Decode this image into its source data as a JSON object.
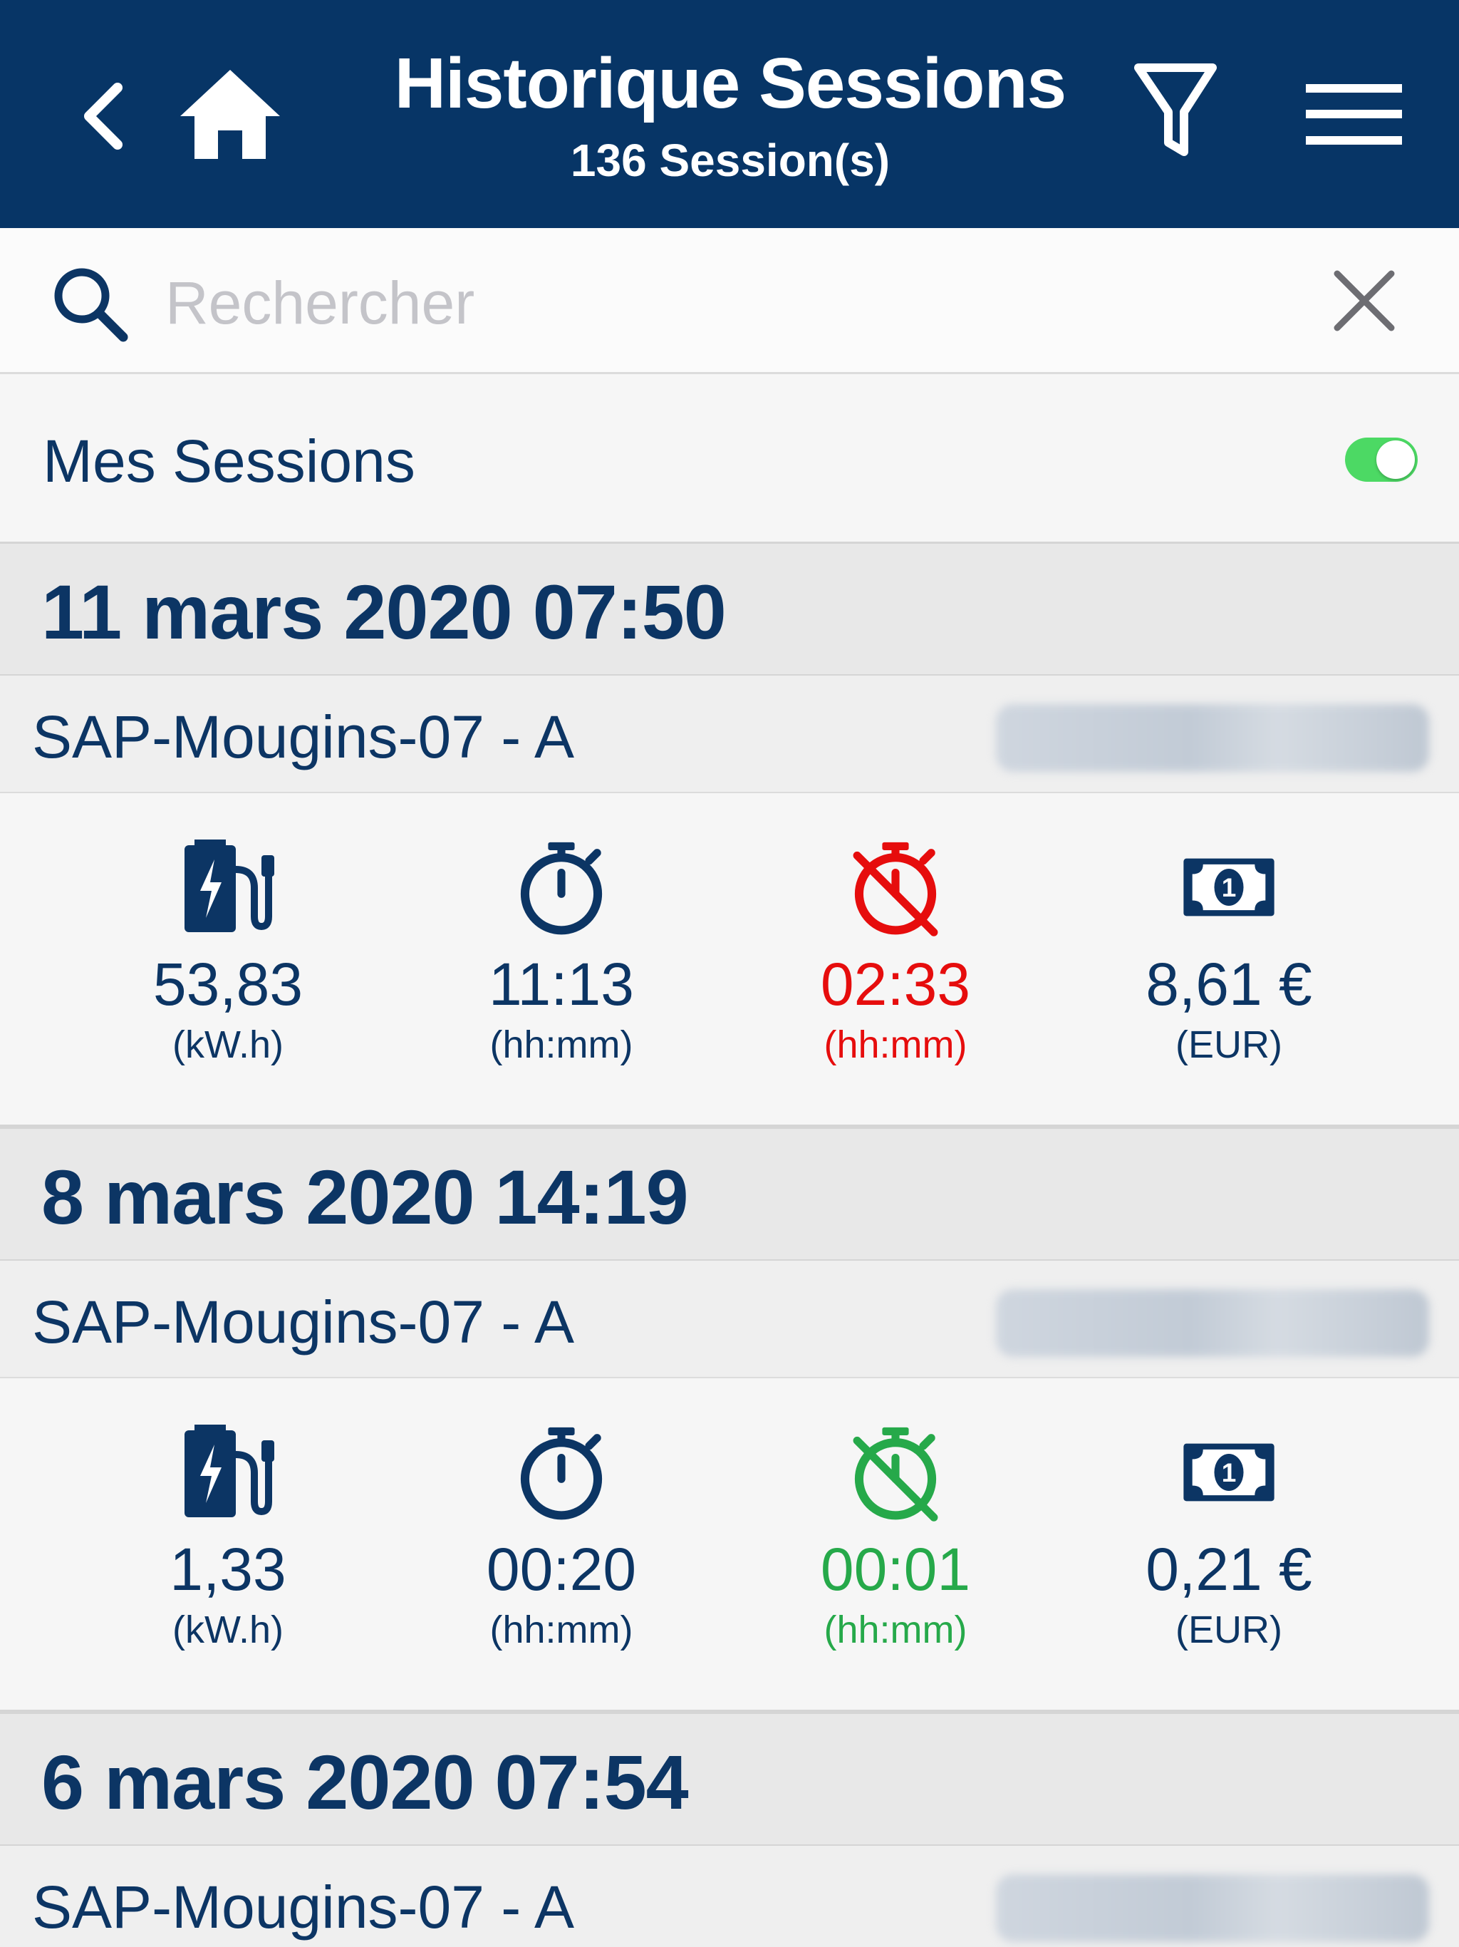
{
  "header": {
    "title": "Historique Sessions",
    "subtitle": "136 Session(s)",
    "back_icon": "chevron-left-icon",
    "home_icon": "home-icon",
    "filter_icon": "filter-icon",
    "menu_icon": "hamburger-menu-icon",
    "background_color": "#073566"
  },
  "search": {
    "placeholder": "Rechercher",
    "value": "",
    "search_icon": "search-icon",
    "clear_icon": "close-icon"
  },
  "my_sessions": {
    "label": "Mes Sessions",
    "toggle_on": true,
    "toggle_color": "#4cd964"
  },
  "sessions": [
    {
      "date": "11 mars 2020 07:50",
      "station": "SAP-Mougins-07 - A",
      "energy": {
        "value": "53,83",
        "unit": "(kW.h)"
      },
      "duration": {
        "value": "11:13",
        "unit": "(hh:mm)"
      },
      "idle": {
        "value": "02:33",
        "unit": "(hh:mm)",
        "status": "red"
      },
      "cost": {
        "value": "8,61 €",
        "unit": "(EUR)"
      }
    },
    {
      "date": "8 mars 2020 14:19",
      "station": "SAP-Mougins-07 - A",
      "energy": {
        "value": "1,33",
        "unit": "(kW.h)"
      },
      "duration": {
        "value": "00:20",
        "unit": "(hh:mm)"
      },
      "idle": {
        "value": "00:01",
        "unit": "(hh:mm)",
        "status": "green"
      },
      "cost": {
        "value": "0,21 €",
        "unit": "(EUR)"
      }
    },
    {
      "date": "6 mars 2020 07:54",
      "station": "SAP-Mougins-07 - A"
    }
  ],
  "colors": {
    "primary": "#0c3564",
    "alert": "#e60d0d",
    "ok": "#26a94a"
  }
}
